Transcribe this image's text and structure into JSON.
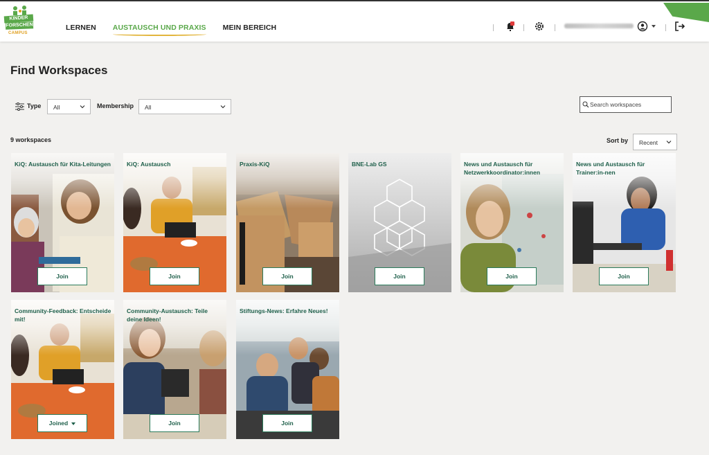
{
  "header": {
    "logo": {
      "top": "KINDER",
      "bottom": "FORSCHEN",
      "sub": "CAMPUS"
    },
    "nav": [
      {
        "label": "LERNEN",
        "active": false
      },
      {
        "label": "AUSTAUSCH UND PRAXIS",
        "active": true
      },
      {
        "label": "MEIN BEREICH",
        "active": false
      }
    ],
    "accent_color": "#5aa84a"
  },
  "page": {
    "title": "Find Workspaces",
    "filters": {
      "type_label": "Type",
      "type_value": "All",
      "membership_label": "Membership",
      "membership_value": "All"
    },
    "search": {
      "placeholder": "Search workspaces"
    },
    "count_label": "9 workspaces",
    "sort": {
      "label": "Sort by",
      "value": "Recent"
    }
  },
  "workspaces": [
    {
      "title": "KiQ: Austausch für Kita-Leitungen",
      "action": "Join"
    },
    {
      "title": "KiQ: Austausch",
      "action": "Join"
    },
    {
      "title": "Praxis-KiQ",
      "action": "Join"
    },
    {
      "title": "BNE-Lab GS",
      "action": "Join"
    },
    {
      "title": "News und Austausch für Netzwerkkoordinator:innen",
      "action": "Join"
    },
    {
      "title": "News und Austausch für Trainer:in-nen",
      "action": "Join"
    },
    {
      "title": "Community-Feedback: Entscheide mit!",
      "action": "Joined"
    },
    {
      "title": "Community-Austausch: Teile deine Ideen!",
      "action": "Join"
    },
    {
      "title": "Stiftungs-News: Erfahre Neues!",
      "action": "Join"
    }
  ]
}
